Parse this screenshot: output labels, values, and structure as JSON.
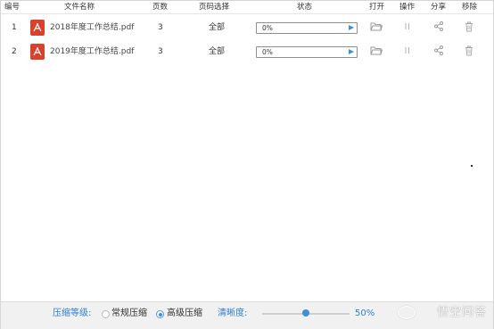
{
  "header": {
    "col_index": "编号",
    "col_filename": "文件名称",
    "col_pages": "页数",
    "col_page_select": "页码选择",
    "col_status": "状态",
    "col_open": "打开",
    "col_operate": "操作",
    "col_share": "分享",
    "col_remove": "移除"
  },
  "rows": [
    {
      "index": "1",
      "filename": "2018年度工作总结.pdf",
      "pages": "3",
      "page_select": "全部",
      "progress_label": "0%",
      "progress": 0
    },
    {
      "index": "2",
      "filename": "2019年度工作总结.pdf",
      "pages": "3",
      "page_select": "全部",
      "progress_label": "0%",
      "progress": 0
    }
  ],
  "icons": {
    "file": "pdf-icon",
    "open": "folder-icon",
    "operate": "pause-icon",
    "share": "share-icon",
    "remove": "trash-icon",
    "start": "play-icon"
  },
  "footer": {
    "compress_level_label": "压缩等级:",
    "option_normal": "常规压缩",
    "option_high": "高级压缩",
    "selected_option": "高级压缩",
    "clarity_label": "清晰度:",
    "clarity_value": "50%",
    "clarity_level": 0.5
  },
  "watermark": "悟空问答",
  "colors": {
    "accent": "#3d8fe0",
    "label_blue": "#2f7fd0",
    "pdf_red": "#d9412b",
    "footer_bg": "#f1f1f1"
  }
}
